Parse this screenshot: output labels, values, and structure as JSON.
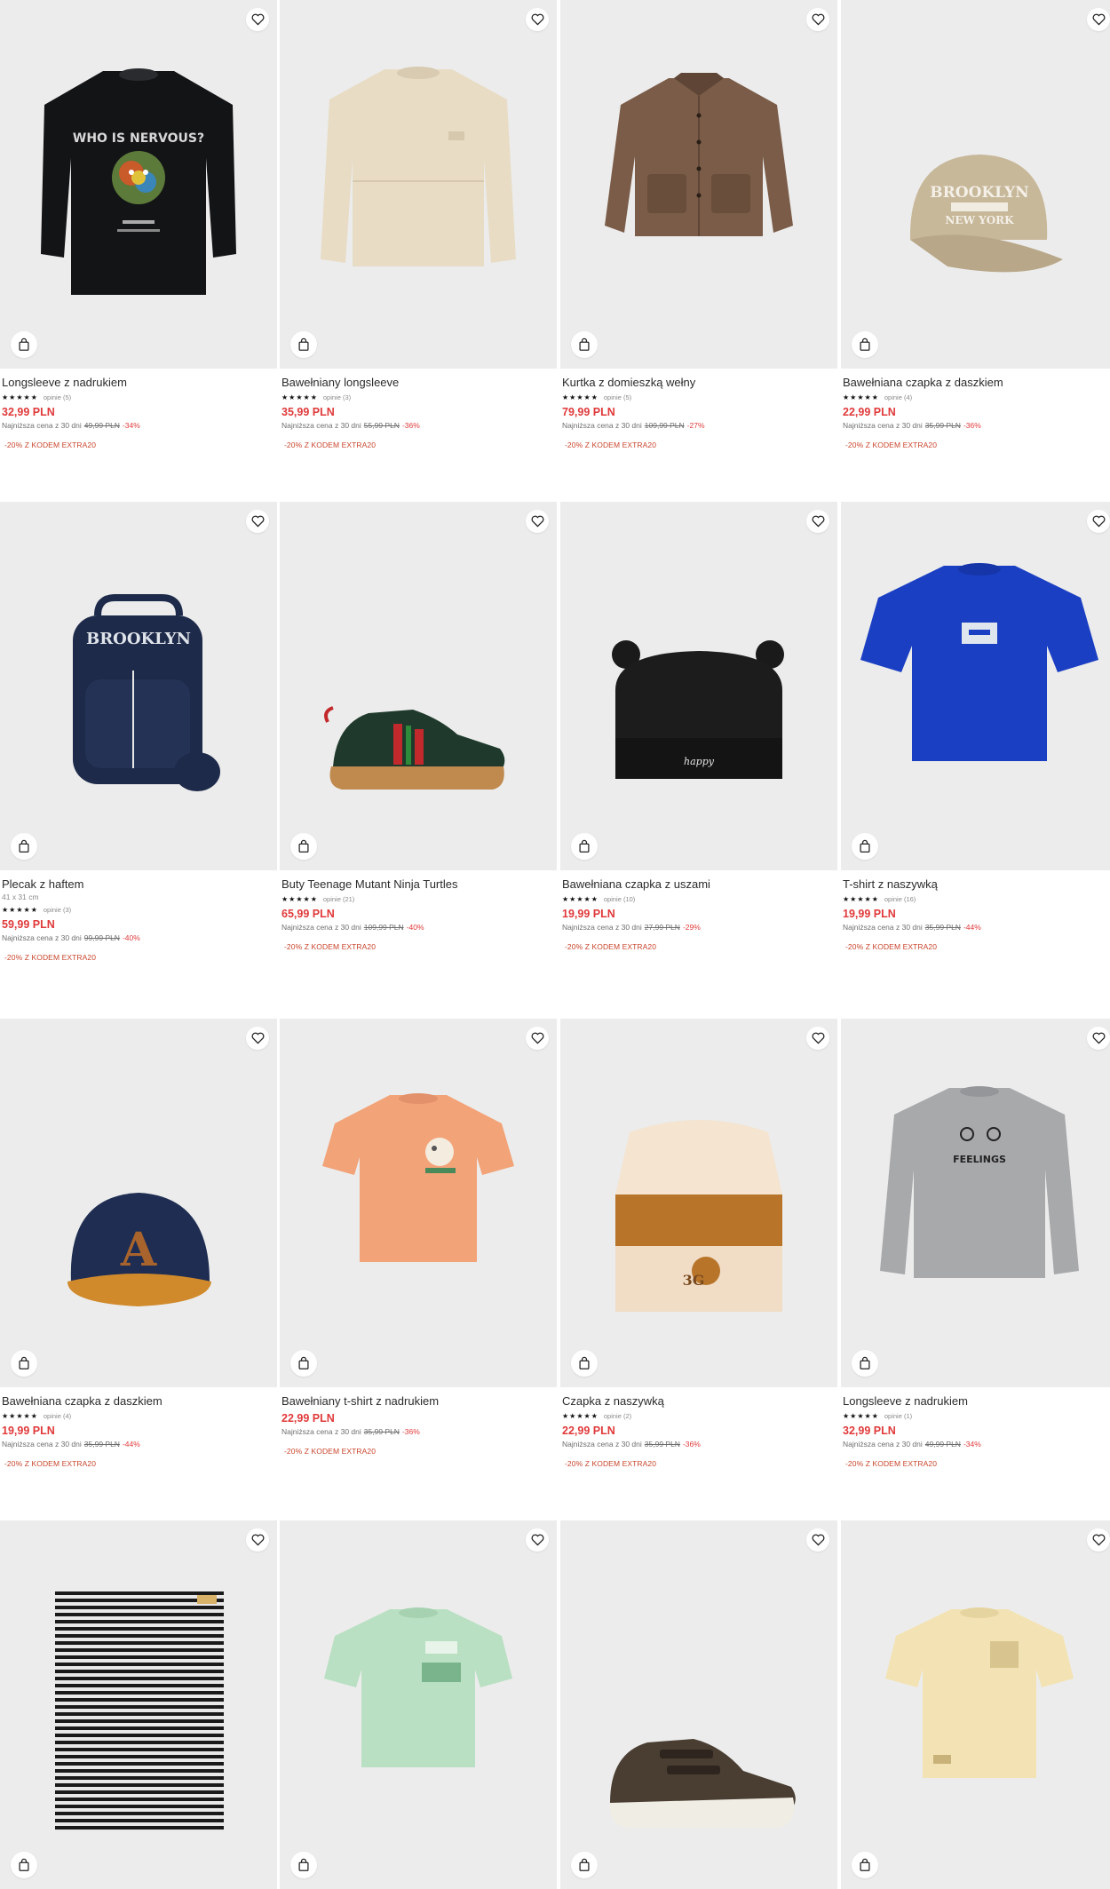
{
  "colors": {
    "price": "#e0393a",
    "promo": "#c9452c",
    "image_bg": "#ececec"
  },
  "icons": {
    "favorite": "heart-icon",
    "add_to_cart": "shopping-bag-icon",
    "rating": "star-icon"
  },
  "products": [
    {
      "name": "Longsleeve z nadrukiem",
      "stars": "★★★★★",
      "reviews": "opinie (5)",
      "price": "32,99 PLN",
      "lowest_label": "Najniższa cena z 30 dni",
      "old_price": "49,99 PLN",
      "discount": "-34%",
      "promo": "-20% Z KODEM EXTRA20"
    },
    {
      "name": "Bawełniany longsleeve",
      "stars": "★★★★★",
      "reviews": "opinie (3)",
      "price": "35,99 PLN",
      "lowest_label": "Najniższa cena z 30 dni",
      "old_price": "55,99 PLN",
      "discount": "-36%",
      "promo": "-20% Z KODEM EXTRA20"
    },
    {
      "name": "Kurtka z domieszką wełny",
      "stars": "★★★★★",
      "reviews": "opinie (5)",
      "price": "79,99 PLN",
      "lowest_label": "Najniższa cena z 30 dni",
      "old_price": "109,99 PLN",
      "discount": "-27%",
      "promo": "-20% Z KODEM EXTRA20"
    },
    {
      "name": "Bawełniana czapka z daszkiem",
      "stars": "★★★★★",
      "reviews": "opinie (4)",
      "price": "22,99 PLN",
      "lowest_label": "Najniższa cena z 30 dni",
      "old_price": "35,99 PLN",
      "discount": "-36%",
      "promo": "-20% Z KODEM EXTRA20"
    },
    {
      "name": "Plecak z haftem",
      "size": "41 x 31 cm",
      "stars": "★★★★★",
      "reviews": "opinie (3)",
      "price": "59,99 PLN",
      "lowest_label": "Najniższa cena z 30 dni",
      "old_price": "99,99 PLN",
      "discount": "-40%",
      "promo": "-20% Z KODEM EXTRA20"
    },
    {
      "name": "Buty Teenage Mutant Ninja Turtles",
      "stars": "★★★★★",
      "reviews": "opinie (21)",
      "price": "65,99 PLN",
      "lowest_label": "Najniższa cena z 30 dni",
      "old_price": "109,99 PLN",
      "discount": "-40%",
      "promo": "-20% Z KODEM EXTRA20"
    },
    {
      "name": "Bawełniana czapka z uszami",
      "stars": "★★★★★",
      "reviews": "opinie (10)",
      "price": "19,99 PLN",
      "lowest_label": "Najniższa cena z 30 dni",
      "old_price": "27,99 PLN",
      "discount": "-29%",
      "promo": "-20% Z KODEM EXTRA20"
    },
    {
      "name": "T-shirt z naszywką",
      "stars": "★★★★★",
      "reviews": "opinie (16)",
      "price": "19,99 PLN",
      "lowest_label": "Najniższa cena z 30 dni",
      "old_price": "35,99 PLN",
      "discount": "-44%",
      "promo": "-20% Z KODEM EXTRA20"
    },
    {
      "name": "Bawełniana czapka z daszkiem",
      "stars": "★★★★★",
      "reviews": "opinie (4)",
      "price": "19,99 PLN",
      "lowest_label": "Najniższa cena z 30 dni",
      "old_price": "35,99 PLN",
      "discount": "-44%",
      "promo": "-20% Z KODEM EXTRA20"
    },
    {
      "name": "Bawełniany t-shirt z nadrukiem",
      "price": "22,99 PLN",
      "lowest_label": "Najniższa cena z 30 dni",
      "old_price": "35,99 PLN",
      "discount": "-36%",
      "promo": "-20% Z KODEM EXTRA20"
    },
    {
      "name": "Czapka z naszywką",
      "stars": "★★★★★",
      "reviews": "opinie (2)",
      "price": "22,99 PLN",
      "lowest_label": "Najniższa cena z 30 dni",
      "old_price": "35,99 PLN",
      "discount": "-36%",
      "promo": "-20% Z KODEM EXTRA20"
    },
    {
      "name": "Longsleeve z nadrukiem",
      "stars": "★★★★★",
      "reviews": "opinie (1)",
      "price": "32,99 PLN",
      "lowest_label": "Najniższa cena z 30 dni",
      "old_price": "49,99 PLN",
      "discount": "-34%",
      "promo": "-20% Z KODEM EXTRA20"
    },
    {},
    {},
    {},
    {}
  ],
  "artwork_text": {
    "nervous": "WHO IS NERVOUS?",
    "brooklyn": "BROOKLYN",
    "brooklyn_cap_1": "BROOKLYN",
    "brooklyn_cap_2": "NEW YORK",
    "happy": "happy",
    "letter_a": "A",
    "beanie_badge": "3G",
    "feelings": "FEELINGS"
  }
}
